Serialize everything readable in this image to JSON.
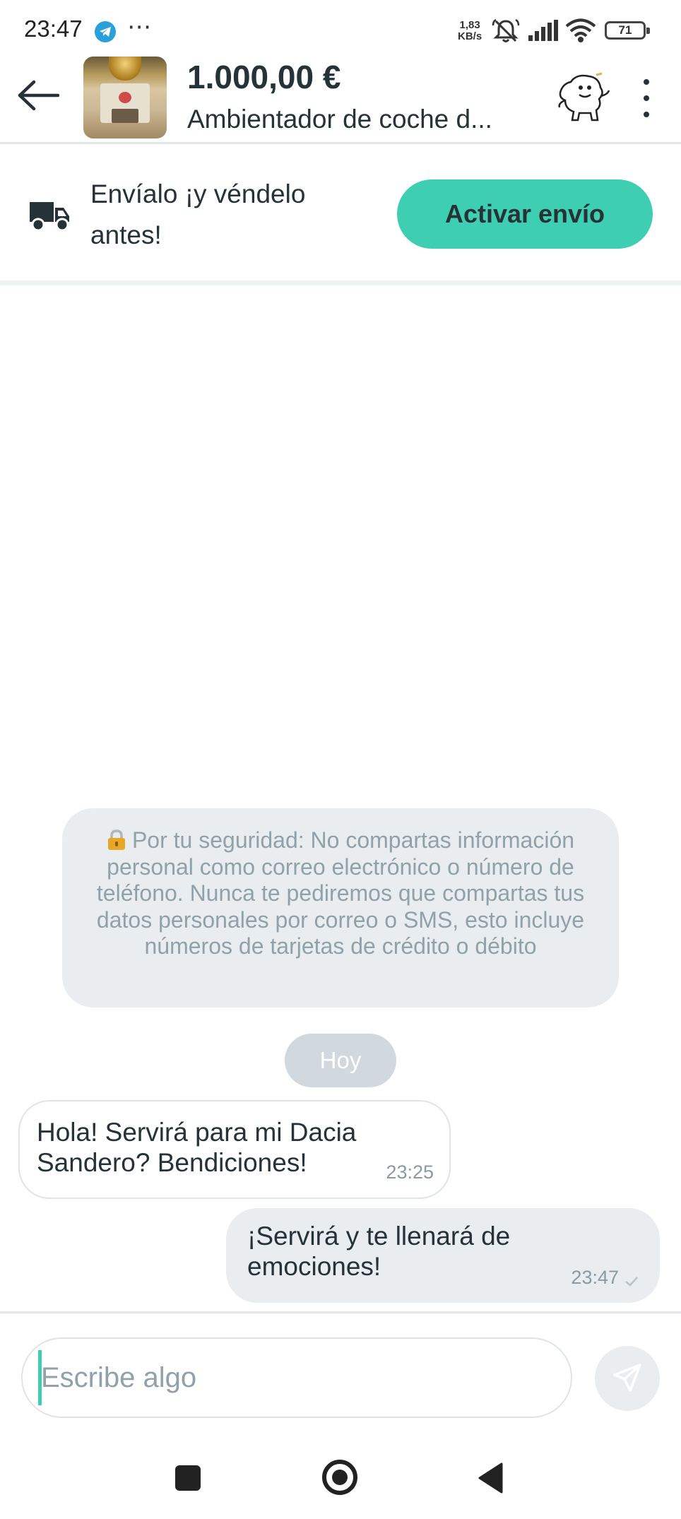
{
  "status_bar": {
    "time": "23:47",
    "more": "⋯",
    "speed_value": "1,83",
    "speed_unit": "KB/s",
    "battery": "71"
  },
  "header": {
    "price": "1.000,00 €",
    "product_title": "Ambientador de coche d...",
    "icons": [
      "back-arrow-icon",
      "product-thumbnail",
      "user-avatar",
      "more-vert-icon"
    ]
  },
  "shipping": {
    "text": "Envíalo ¡y véndelo antes!",
    "button_label": "Activar envío",
    "icon": "truck-icon",
    "button_color": "#3ecfb3"
  },
  "chat": {
    "security_notice": "Por tu seguridad: No compartas información personal como correo electrónico o número de teléfono. Nunca te pediremos que compartas tus datos personales por correo o SMS, esto incluye números de tarjetas de crédito o débito",
    "date_label": "Hoy",
    "messages": [
      {
        "direction": "incoming",
        "text": "Hola! Servirá para mi Dacia Sandero? Bendiciones!",
        "time": "23:25"
      },
      {
        "direction": "outgoing",
        "text": "¡Servirá y te llenará de emociones!",
        "time": "23:47"
      }
    ]
  },
  "composer": {
    "placeholder": "Escribe algo",
    "send_icon": "send-icon"
  },
  "nav": {
    "icons": [
      "recents-icon",
      "home-icon",
      "back-icon"
    ]
  }
}
